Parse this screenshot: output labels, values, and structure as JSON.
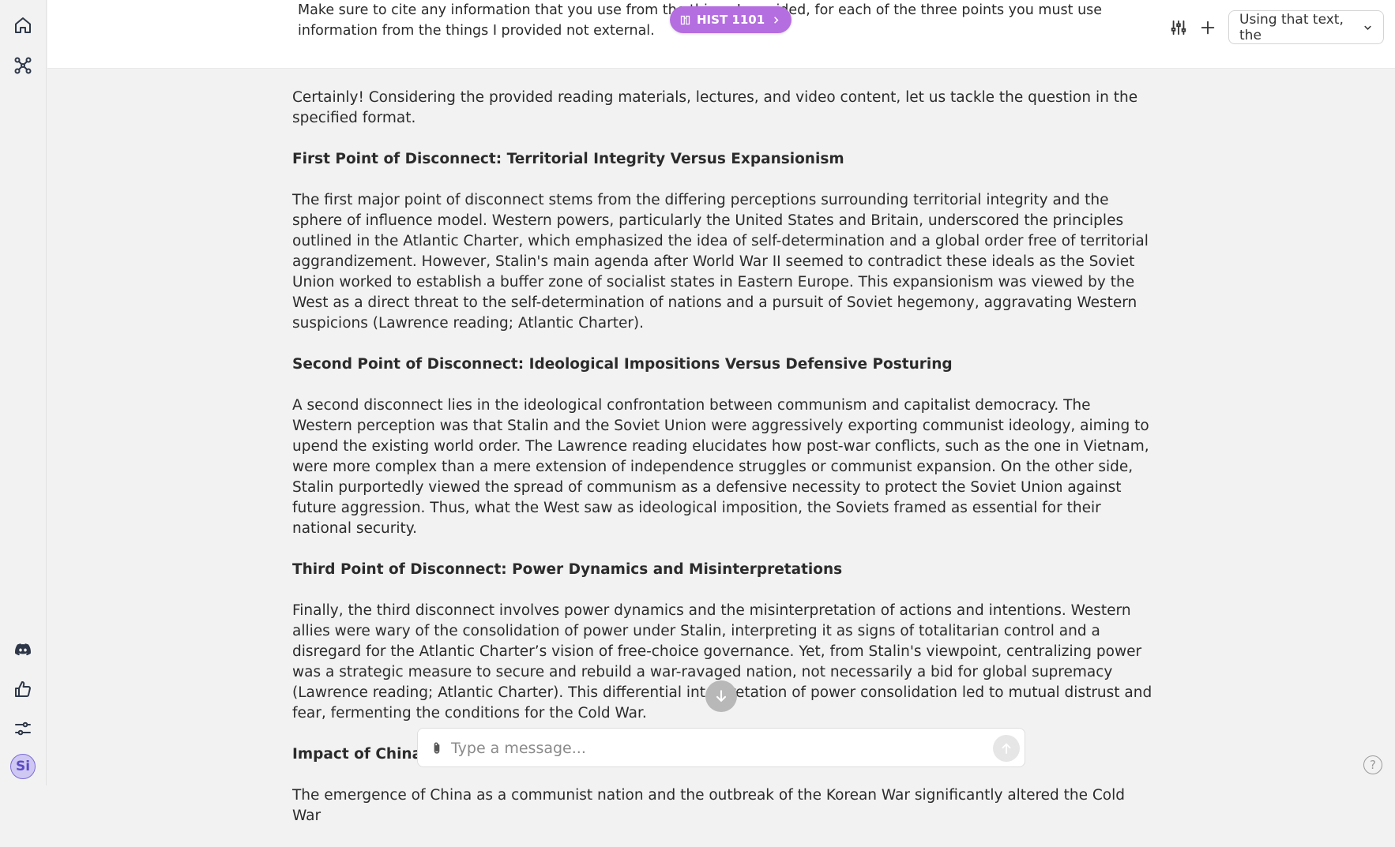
{
  "sidebar": {
    "avatar_initials": "Si",
    "icons": [
      "home-icon",
      "graph-nodes-icon",
      "discord-icon",
      "thumbs-up-icon",
      "sliders-icon"
    ]
  },
  "header": {
    "prompt": "Make sure to cite any information that you use from the things I provided, for each of the three points you must use information from the things I provided not external.",
    "course_pill": "HIST 1101",
    "model_select": "Using that text, the"
  },
  "response": {
    "intro": "Certainly! Considering the provided reading materials, lectures, and video content, let us tackle the question in the specified format.",
    "sections": [
      {
        "heading": "First Point of Disconnect: Territorial Integrity Versus Expansionism",
        "body": "The first major point of disconnect stems from the differing perceptions surrounding territorial integrity and the sphere of influence model. Western powers, particularly the United States and Britain, underscored the principles outlined in the Atlantic Charter, which emphasized the idea of self-determination and a global order free of territorial aggrandizement. However, Stalin's main agenda after World War II seemed to contradict these ideals as the Soviet Union worked to establish a buffer zone of socialist states in Eastern Europe. This expansionism was viewed by the West as a direct threat to the self-determination of nations and a pursuit of Soviet hegemony, aggravating Western suspicions (Lawrence reading; Atlantic Charter)."
      },
      {
        "heading": "Second Point of Disconnect: Ideological Impositions Versus Defensive Posturing",
        "body": "A second disconnect lies in the ideological confrontation between communism and capitalist democracy. The Western perception was that Stalin and the Soviet Union were aggressively exporting communist ideology, aiming to upend the existing world order. The Lawrence reading elucidates how post-war conflicts, such as the one in Vietnam, were more complex than a mere extension of independence struggles or communist expansion. On the other side, Stalin purportedly viewed the spread of communism as a defensive necessity to protect the Soviet Union against future aggression. Thus, what the West saw as ideological imposition, the Soviets framed as essential for their national security."
      },
      {
        "heading": "Third Point of Disconnect: Power Dynamics and Misinterpretations",
        "body": "Finally, the third disconnect involves power dynamics and the misinterpretation of actions and intentions. Western allies were wary of the consolidation of power under Stalin, interpreting it as signs of totalitarian control and a disregard for the Atlantic Charter’s vision of free-choice governance. Yet, from Stalin's viewpoint, centralizing power was a strategic measure to secure and rebuild a war-ravaged nation, not necessarily a bid for global supremacy (Lawrence reading; Atlantic Charter). This differential interpretation of power consolidation led to mutual distrust and fear, fermenting the conditions for the Cold War."
      },
      {
        "heading": "Impact of China a",
        "body": "The emergence of China as a communist nation and the outbreak of the Korean War significantly altered the Cold War"
      }
    ]
  },
  "composer": {
    "placeholder": "Type a message..."
  },
  "help_label": "?"
}
